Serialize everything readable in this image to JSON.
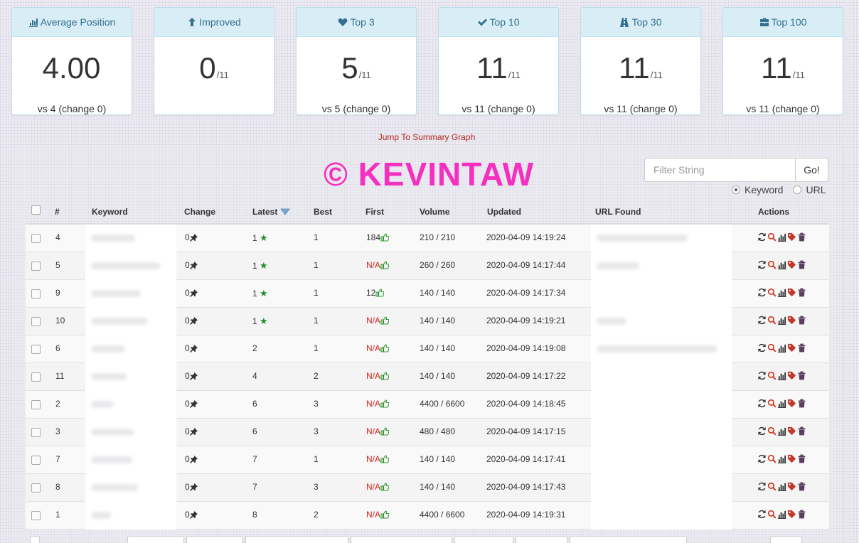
{
  "cards": [
    {
      "icon": "bar-chart-icon",
      "label": "Average Position",
      "value": "4.00",
      "denom": "",
      "foot": "vs 4 (change 0)"
    },
    {
      "icon": "arrow-up-icon",
      "label": "Improved",
      "value": "0",
      "denom": "/11",
      "foot": ""
    },
    {
      "icon": "heart-icon",
      "label": "Top 3",
      "value": "5",
      "denom": "/11",
      "foot": "vs 5 (change 0)"
    },
    {
      "icon": "check-icon",
      "label": "Top 10",
      "value": "11",
      "denom": "/11",
      "foot": "vs 11 (change 0)"
    },
    {
      "icon": "road-icon",
      "label": "Top 30",
      "value": "11",
      "denom": "/11",
      "foot": "vs 11 (change 0)"
    },
    {
      "icon": "briefcase-icon",
      "label": "Top 100",
      "value": "11",
      "denom": "/11",
      "foot": "vs 11 (change 0)"
    }
  ],
  "jump_link": "Jump To Summary Graph",
  "watermark": "© KEVINTAW",
  "filter": {
    "placeholder": "Filter String",
    "go_label": "Go!",
    "options": [
      "Keyword",
      "URL"
    ],
    "selected": "Keyword"
  },
  "columns": {
    "num": "#",
    "keyword": "Keyword",
    "change": "Change",
    "latest": "Latest",
    "best": "Best",
    "first": "First",
    "volume": "Volume",
    "updated": "Updated",
    "url": "URL Found",
    "actions": "Actions"
  },
  "rows": [
    {
      "num": "4",
      "change": "0",
      "latest": "1",
      "top": true,
      "best": "1",
      "first": "184",
      "volume": "210 / 210",
      "updated": "2020-04-09 14:19:24"
    },
    {
      "num": "5",
      "change": "0",
      "latest": "1",
      "top": true,
      "best": "1",
      "first": "N/A",
      "volume": "260 / 260",
      "updated": "2020-04-09 14:17:44"
    },
    {
      "num": "9",
      "change": "0",
      "latest": "1",
      "top": true,
      "best": "1",
      "first": "12",
      "volume": "140 / 140",
      "updated": "2020-04-09 14:17:34"
    },
    {
      "num": "10",
      "change": "0",
      "latest": "1",
      "top": true,
      "best": "1",
      "first": "N/A",
      "volume": "140 / 140",
      "updated": "2020-04-09 14:19:21"
    },
    {
      "num": "6",
      "change": "0",
      "latest": "2",
      "top": false,
      "best": "1",
      "first": "N/A",
      "volume": "140 / 140",
      "updated": "2020-04-09 14:19:08"
    },
    {
      "num": "11",
      "change": "0",
      "latest": "4",
      "top": false,
      "best": "2",
      "first": "N/A",
      "volume": "140 / 140",
      "updated": "2020-04-09 14:17:22"
    },
    {
      "num": "2",
      "change": "0",
      "latest": "6",
      "top": false,
      "best": "3",
      "first": "N/A",
      "volume": "4400 / 6600",
      "updated": "2020-04-09 14:18:45"
    },
    {
      "num": "3",
      "change": "0",
      "latest": "6",
      "top": false,
      "best": "3",
      "first": "N/A",
      "volume": "480 / 480",
      "updated": "2020-04-09 14:17:15"
    },
    {
      "num": "7",
      "change": "0",
      "latest": "7",
      "top": false,
      "best": "1",
      "first": "N/A",
      "volume": "140 / 140",
      "updated": "2020-04-09 14:17:41"
    },
    {
      "num": "8",
      "change": "0",
      "latest": "7",
      "top": false,
      "best": "3",
      "first": "N/A",
      "volume": "140 / 140",
      "updated": "2020-04-09 14:17:43"
    },
    {
      "num": "1",
      "change": "0",
      "latest": "8",
      "top": false,
      "best": "2",
      "first": "N/A",
      "volume": "4400 / 6600",
      "updated": "2020-04-09 14:19:31"
    }
  ],
  "colors": {
    "header_bg": "#d9edf7",
    "header_text": "#31708f",
    "na": "#d9221d",
    "star": "#1e8f2e",
    "watermark": "#f52fc0",
    "action_icon": "#c0392b"
  }
}
